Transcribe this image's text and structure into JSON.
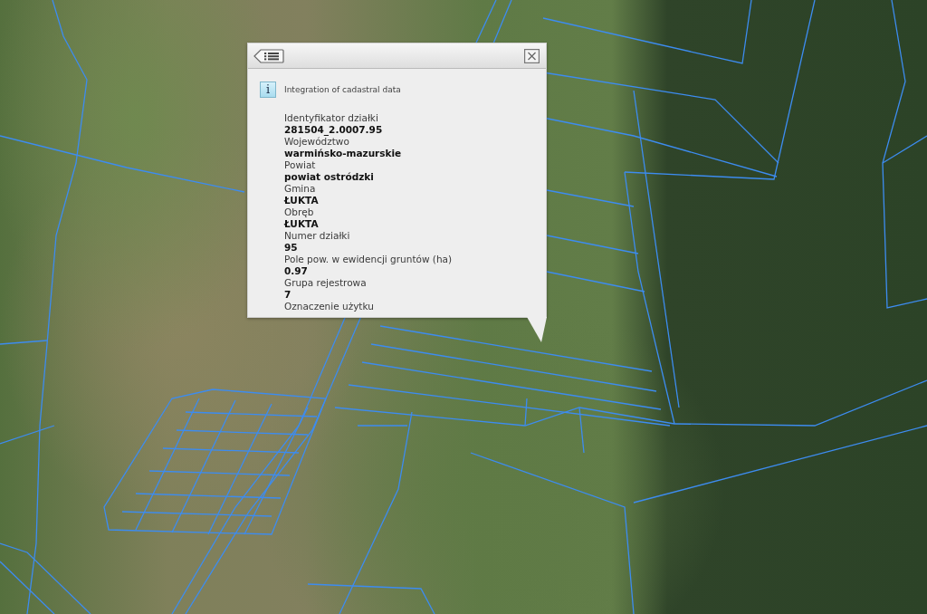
{
  "popup": {
    "info_icon": "i",
    "title": "Integration of cadastral data",
    "fields": [
      {
        "label": "Identyfikator działki",
        "value": "281504_2.0007.95"
      },
      {
        "label": "Województwo",
        "value": "warmińsko-mazurskie"
      },
      {
        "label": "Powiat",
        "value": "powiat ostródzki"
      },
      {
        "label": "Gmina",
        "value": "ŁUKTA"
      },
      {
        "label": "Obręb",
        "value": "ŁUKTA"
      },
      {
        "label": "Numer działki",
        "value": "95"
      },
      {
        "label": "Pole pow. w ewidencji gruntów (ha)",
        "value": "0.97"
      },
      {
        "label": "Grupa rejestrowa",
        "value": "7"
      },
      {
        "label": "Oznaczenie użytku"
      }
    ]
  }
}
